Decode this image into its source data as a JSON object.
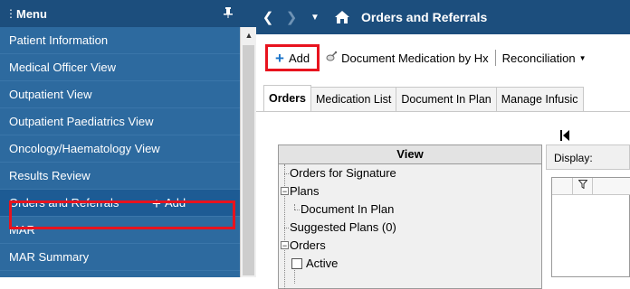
{
  "sidebar": {
    "title": "Menu",
    "items": [
      {
        "label": "Patient Information"
      },
      {
        "label": "Medical Officer View"
      },
      {
        "label": "Outpatient View"
      },
      {
        "label": "Outpatient Paediatrics View"
      },
      {
        "label": "Oncology/Haematology View"
      },
      {
        "label": "Results Review"
      },
      {
        "label": "Orders and Referrals",
        "add_label": "Add",
        "highlighted": true
      },
      {
        "label": "MAR"
      },
      {
        "label": "MAR Summary"
      }
    ]
  },
  "titlebar": {
    "title": "Orders and Referrals"
  },
  "toolbar": {
    "add_label": "Add",
    "document_medication_label": "Document Medication by Hx",
    "reconciliation_label": "Reconciliation"
  },
  "tabs": [
    {
      "label": "Orders",
      "active": true
    },
    {
      "label": "Medication List"
    },
    {
      "label": "Document In Plan"
    },
    {
      "label": "Manage Infusic"
    }
  ],
  "view_panel": {
    "header": "View",
    "tree": {
      "orders_for_signature": "Orders for Signature",
      "plans": "Plans",
      "document_in_plan": "Document In Plan",
      "suggested_plans": "Suggested Plans (0)",
      "orders": "Orders",
      "active": "Active"
    }
  },
  "display": {
    "label": "Display:"
  },
  "colors": {
    "sidebar_bg": "#2d6a9f",
    "header_bg": "#1c4e7d",
    "highlight_red": "#e8131e",
    "add_blue": "#1a73c8"
  }
}
